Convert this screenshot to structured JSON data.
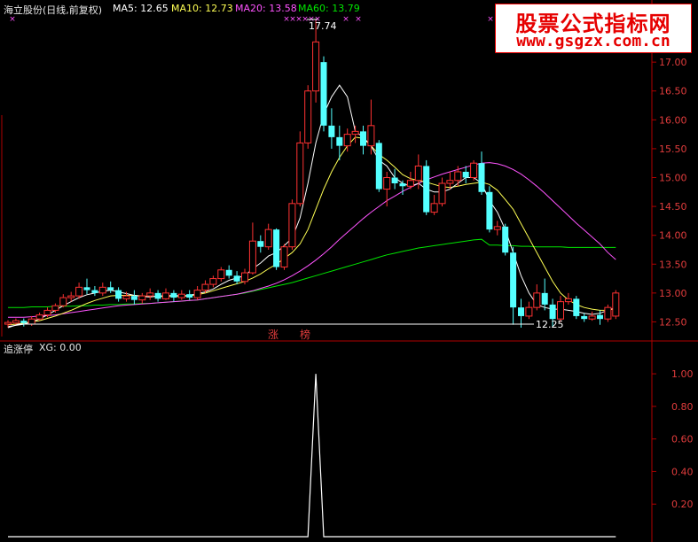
{
  "header": {
    "stock": "海立股份(日线,前复权)",
    "ma5_label": "MA5: 12.65",
    "ma10_label": "MA10: 12.73",
    "ma20_label": "MA20: 13.58",
    "ma60_label": "MA60: 13.79"
  },
  "indicator_header": {
    "name": "追涨停",
    "value_label": "XG: 0.00"
  },
  "watermark": {
    "title": "股票公式指标网",
    "url": "www.gsgzx.com.cn"
  },
  "annotations": {
    "high_label": "17.74",
    "low_label": "12.25",
    "marker_1": "涨",
    "marker_2": "榜"
  },
  "colors": {
    "up": "#ff3232",
    "down": "#54ffff",
    "ma5": "#ffffff",
    "ma10": "#ffff54",
    "ma20": "#ff54ff",
    "ma60": "#00e600",
    "axis": "#b00000",
    "tick_label": "#e03c3c"
  },
  "chart_data": [
    {
      "type": "candlestick",
      "title": "海立股份(日线,前复权)",
      "ylim": [
        12.2,
        17.8
      ],
      "y_ticks": [
        12.5,
        13.0,
        13.5,
        14.0,
        14.5,
        15.0,
        15.5,
        16.0,
        16.5,
        17.0
      ],
      "candles": [
        [
          12.46,
          12.49,
          12.4,
          12.53
        ],
        [
          12.48,
          12.52,
          12.45,
          12.56
        ],
        [
          12.52,
          12.48,
          12.42,
          12.56
        ],
        [
          12.46,
          12.55,
          12.43,
          12.6
        ],
        [
          12.55,
          12.62,
          12.52,
          12.66
        ],
        [
          12.62,
          12.7,
          12.58,
          12.75
        ],
        [
          12.7,
          12.78,
          12.66,
          12.82
        ],
        [
          12.78,
          12.92,
          12.75,
          12.98
        ],
        [
          12.92,
          12.95,
          12.85,
          13.02
        ],
        [
          12.95,
          13.1,
          12.9,
          13.18
        ],
        [
          13.1,
          13.05,
          12.98,
          13.25
        ],
        [
          13.05,
          13.0,
          12.95,
          13.12
        ],
        [
          13.0,
          13.1,
          12.95,
          13.18
        ],
        [
          13.1,
          13.05,
          13.0,
          13.2
        ],
        [
          13.05,
          12.9,
          12.85,
          13.1
        ],
        [
          12.9,
          12.95,
          12.85,
          13.02
        ],
        [
          12.95,
          12.88,
          12.8,
          13.05
        ],
        [
          12.88,
          12.95,
          12.82,
          13.0
        ],
        [
          12.95,
          13.0,
          12.88,
          13.08
        ],
        [
          13.0,
          12.9,
          12.85,
          13.05
        ],
        [
          12.9,
          13.0,
          12.88,
          13.08
        ],
        [
          13.0,
          12.92,
          12.85,
          13.05
        ],
        [
          12.92,
          12.98,
          12.88,
          13.05
        ],
        [
          12.98,
          12.92,
          12.88,
          13.05
        ],
        [
          12.92,
          13.05,
          12.88,
          13.12
        ],
        [
          13.05,
          13.15,
          13.0,
          13.22
        ],
        [
          13.15,
          13.25,
          13.1,
          13.3
        ],
        [
          13.25,
          13.4,
          13.2,
          13.45
        ],
        [
          13.4,
          13.3,
          13.25,
          13.48
        ],
        [
          13.3,
          13.2,
          13.15,
          13.38
        ],
        [
          13.2,
          13.35,
          13.15,
          13.42
        ],
        [
          13.35,
          13.9,
          13.32,
          14.22
        ],
        [
          13.9,
          13.8,
          13.7,
          14.0
        ],
        [
          13.8,
          14.1,
          13.75,
          14.2
        ],
        [
          14.1,
          13.45,
          13.4,
          14.12
        ],
        [
          13.45,
          13.8,
          13.4,
          13.85
        ],
        [
          13.8,
          14.55,
          13.75,
          14.62
        ],
        [
          14.55,
          15.6,
          14.5,
          15.8
        ],
        [
          15.6,
          16.5,
          15.5,
          16.6
        ],
        [
          16.5,
          17.35,
          16.3,
          17.74
        ],
        [
          17.0,
          15.9,
          15.8,
          17.1
        ],
        [
          15.9,
          15.7,
          15.5,
          16.2
        ],
        [
          15.7,
          15.55,
          15.3,
          15.9
        ],
        [
          15.55,
          15.75,
          15.45,
          15.85
        ],
        [
          15.75,
          15.8,
          15.6,
          15.9
        ],
        [
          15.8,
          15.55,
          15.4,
          15.9
        ],
        [
          15.55,
          15.9,
          15.4,
          16.35
        ],
        [
          15.6,
          14.8,
          14.75,
          15.65
        ],
        [
          14.8,
          15.0,
          14.5,
          15.1
        ],
        [
          15.0,
          14.9,
          14.8,
          15.15
        ],
        [
          14.9,
          14.85,
          14.7,
          14.95
        ],
        [
          14.85,
          14.95,
          14.8,
          15.1
        ],
        [
          14.95,
          15.2,
          14.8,
          15.4
        ],
        [
          15.2,
          14.4,
          14.35,
          15.3
        ],
        [
          14.4,
          14.55,
          14.35,
          14.7
        ],
        [
          14.55,
          14.9,
          14.5,
          15.0
        ],
        [
          14.9,
          14.95,
          14.8,
          15.1
        ],
        [
          14.95,
          15.1,
          14.85,
          15.2
        ],
        [
          15.1,
          15.0,
          14.9,
          15.2
        ],
        [
          15.0,
          15.25,
          14.95,
          15.3
        ],
        [
          15.25,
          14.75,
          14.7,
          15.45
        ],
        [
          14.75,
          14.1,
          14.05,
          14.85
        ],
        [
          14.1,
          14.15,
          14.0,
          14.25
        ],
        [
          14.15,
          13.7,
          13.65,
          14.2
        ],
        [
          13.7,
          12.75,
          12.45,
          13.8
        ],
        [
          12.75,
          12.6,
          12.4,
          12.9
        ],
        [
          12.6,
          12.75,
          12.55,
          12.85
        ],
        [
          12.75,
          13.0,
          12.7,
          13.15
        ],
        [
          13.0,
          12.8,
          12.7,
          13.25
        ],
        [
          12.8,
          12.55,
          12.4,
          12.9
        ],
        [
          12.55,
          12.85,
          12.5,
          12.95
        ],
        [
          12.85,
          12.9,
          12.8,
          13.0
        ],
        [
          12.9,
          12.6,
          12.55,
          12.95
        ],
        [
          12.6,
          12.55,
          12.5,
          12.65
        ],
        [
          12.55,
          12.6,
          12.52,
          12.68
        ],
        [
          12.62,
          12.55,
          12.45,
          12.7
        ],
        [
          12.55,
          12.75,
          12.5,
          12.8
        ],
        [
          12.6,
          13.0,
          12.55,
          13.05
        ]
      ],
      "ma5": [
        12.42,
        12.44,
        12.46,
        12.5,
        12.55,
        12.62,
        12.7,
        12.78,
        12.85,
        12.92,
        12.97,
        13.0,
        13.03,
        13.05,
        13.02,
        12.99,
        12.96,
        12.94,
        12.93,
        12.95,
        12.95,
        12.96,
        12.95,
        12.96,
        12.99,
        13.02,
        13.07,
        13.15,
        13.22,
        13.26,
        13.3,
        13.42,
        13.52,
        13.64,
        13.7,
        13.82,
        13.95,
        14.3,
        14.9,
        15.6,
        16.1,
        16.4,
        16.6,
        16.4,
        15.8,
        15.7,
        15.55,
        15.3,
        15.2,
        15.0,
        14.9,
        14.85,
        14.9,
        14.8,
        14.75,
        14.75,
        14.8,
        14.9,
        15.0,
        15.0,
        14.9,
        14.6,
        14.4,
        14.1,
        13.7,
        13.3,
        13.0,
        12.8,
        12.75,
        12.72,
        12.72,
        12.7,
        12.68,
        12.65,
        12.63,
        12.65,
        12.7,
        12.75
      ],
      "ma10": [
        12.45,
        12.46,
        12.48,
        12.5,
        12.52,
        12.56,
        12.6,
        12.65,
        12.7,
        12.76,
        12.82,
        12.87,
        12.91,
        12.95,
        12.96,
        12.96,
        12.96,
        12.95,
        12.94,
        12.94,
        12.94,
        12.94,
        12.94,
        12.95,
        12.97,
        13.0,
        13.04,
        13.08,
        13.12,
        13.16,
        13.2,
        13.26,
        13.33,
        13.42,
        13.5,
        13.6,
        13.7,
        13.85,
        14.1,
        14.45,
        14.8,
        15.1,
        15.35,
        15.55,
        15.7,
        15.68,
        15.55,
        15.4,
        15.3,
        15.18,
        15.05,
        14.98,
        14.95,
        14.92,
        14.88,
        14.84,
        14.83,
        14.85,
        14.88,
        14.9,
        14.92,
        14.88,
        14.78,
        14.62,
        14.45,
        14.2,
        13.95,
        13.7,
        13.45,
        13.2,
        13.0,
        12.88,
        12.8,
        12.75,
        12.72,
        12.7,
        12.7,
        12.73
      ],
      "ma20": [
        12.58,
        12.58,
        12.58,
        12.59,
        12.6,
        12.61,
        12.62,
        12.64,
        12.66,
        12.68,
        12.7,
        12.72,
        12.74,
        12.76,
        12.78,
        12.79,
        12.8,
        12.81,
        12.82,
        12.83,
        12.84,
        12.85,
        12.86,
        12.87,
        12.88,
        12.9,
        12.92,
        12.94,
        12.96,
        12.98,
        13.01,
        13.04,
        13.08,
        13.12,
        13.17,
        13.23,
        13.3,
        13.38,
        13.47,
        13.57,
        13.68,
        13.8,
        13.93,
        14.05,
        14.17,
        14.29,
        14.4,
        14.5,
        14.6,
        14.68,
        14.76,
        14.83,
        14.9,
        14.96,
        15.01,
        15.06,
        15.1,
        15.14,
        15.18,
        15.22,
        15.25,
        15.26,
        15.24,
        15.2,
        15.14,
        15.06,
        14.96,
        14.85,
        14.73,
        14.6,
        14.47,
        14.34,
        14.21,
        14.09,
        13.97,
        13.85,
        13.7,
        13.58
      ],
      "ma60": [
        12.75,
        12.75,
        12.75,
        12.76,
        12.76,
        12.76,
        12.77,
        12.77,
        12.77,
        12.78,
        12.78,
        12.79,
        12.79,
        12.8,
        12.8,
        12.81,
        12.81,
        12.82,
        12.82,
        12.83,
        12.84,
        12.85,
        12.86,
        12.87,
        12.88,
        12.9,
        12.92,
        12.94,
        12.96,
        12.98,
        13.0,
        13.03,
        13.06,
        13.09,
        13.12,
        13.15,
        13.18,
        13.22,
        13.26,
        13.3,
        13.34,
        13.38,
        13.42,
        13.46,
        13.5,
        13.54,
        13.58,
        13.62,
        13.66,
        13.69,
        13.72,
        13.75,
        13.78,
        13.8,
        13.82,
        13.84,
        13.86,
        13.88,
        13.9,
        13.92,
        13.93,
        13.83,
        13.83,
        13.82,
        13.82,
        13.81,
        13.81,
        13.8,
        13.8,
        13.8,
        13.8,
        13.79,
        13.79,
        13.79,
        13.79,
        13.79,
        13.79,
        13.79
      ]
    },
    {
      "type": "line",
      "title": "追涨停",
      "ylim": [
        0.0,
        1.12
      ],
      "y_ticks": [
        0.2,
        0.4,
        0.6,
        0.8,
        1.0
      ],
      "series": [
        {
          "name": "XG",
          "values": [
            0,
            0,
            0,
            0,
            0,
            0,
            0,
            0,
            0,
            0,
            0,
            0,
            0,
            0,
            0,
            0,
            0,
            0,
            0,
            0,
            0,
            0,
            0,
            0,
            0,
            0,
            0,
            0,
            0,
            0,
            0,
            0,
            0,
            0,
            0,
            0,
            0,
            0,
            0,
            1,
            0,
            0,
            0,
            0,
            0,
            0,
            0,
            0,
            0,
            0,
            0,
            0,
            0,
            0,
            0,
            0,
            0,
            0,
            0,
            0,
            0,
            0,
            0,
            0,
            0,
            0,
            0,
            0,
            0,
            0,
            0,
            0,
            0,
            0,
            0,
            0,
            0,
            0
          ]
        }
      ]
    }
  ]
}
